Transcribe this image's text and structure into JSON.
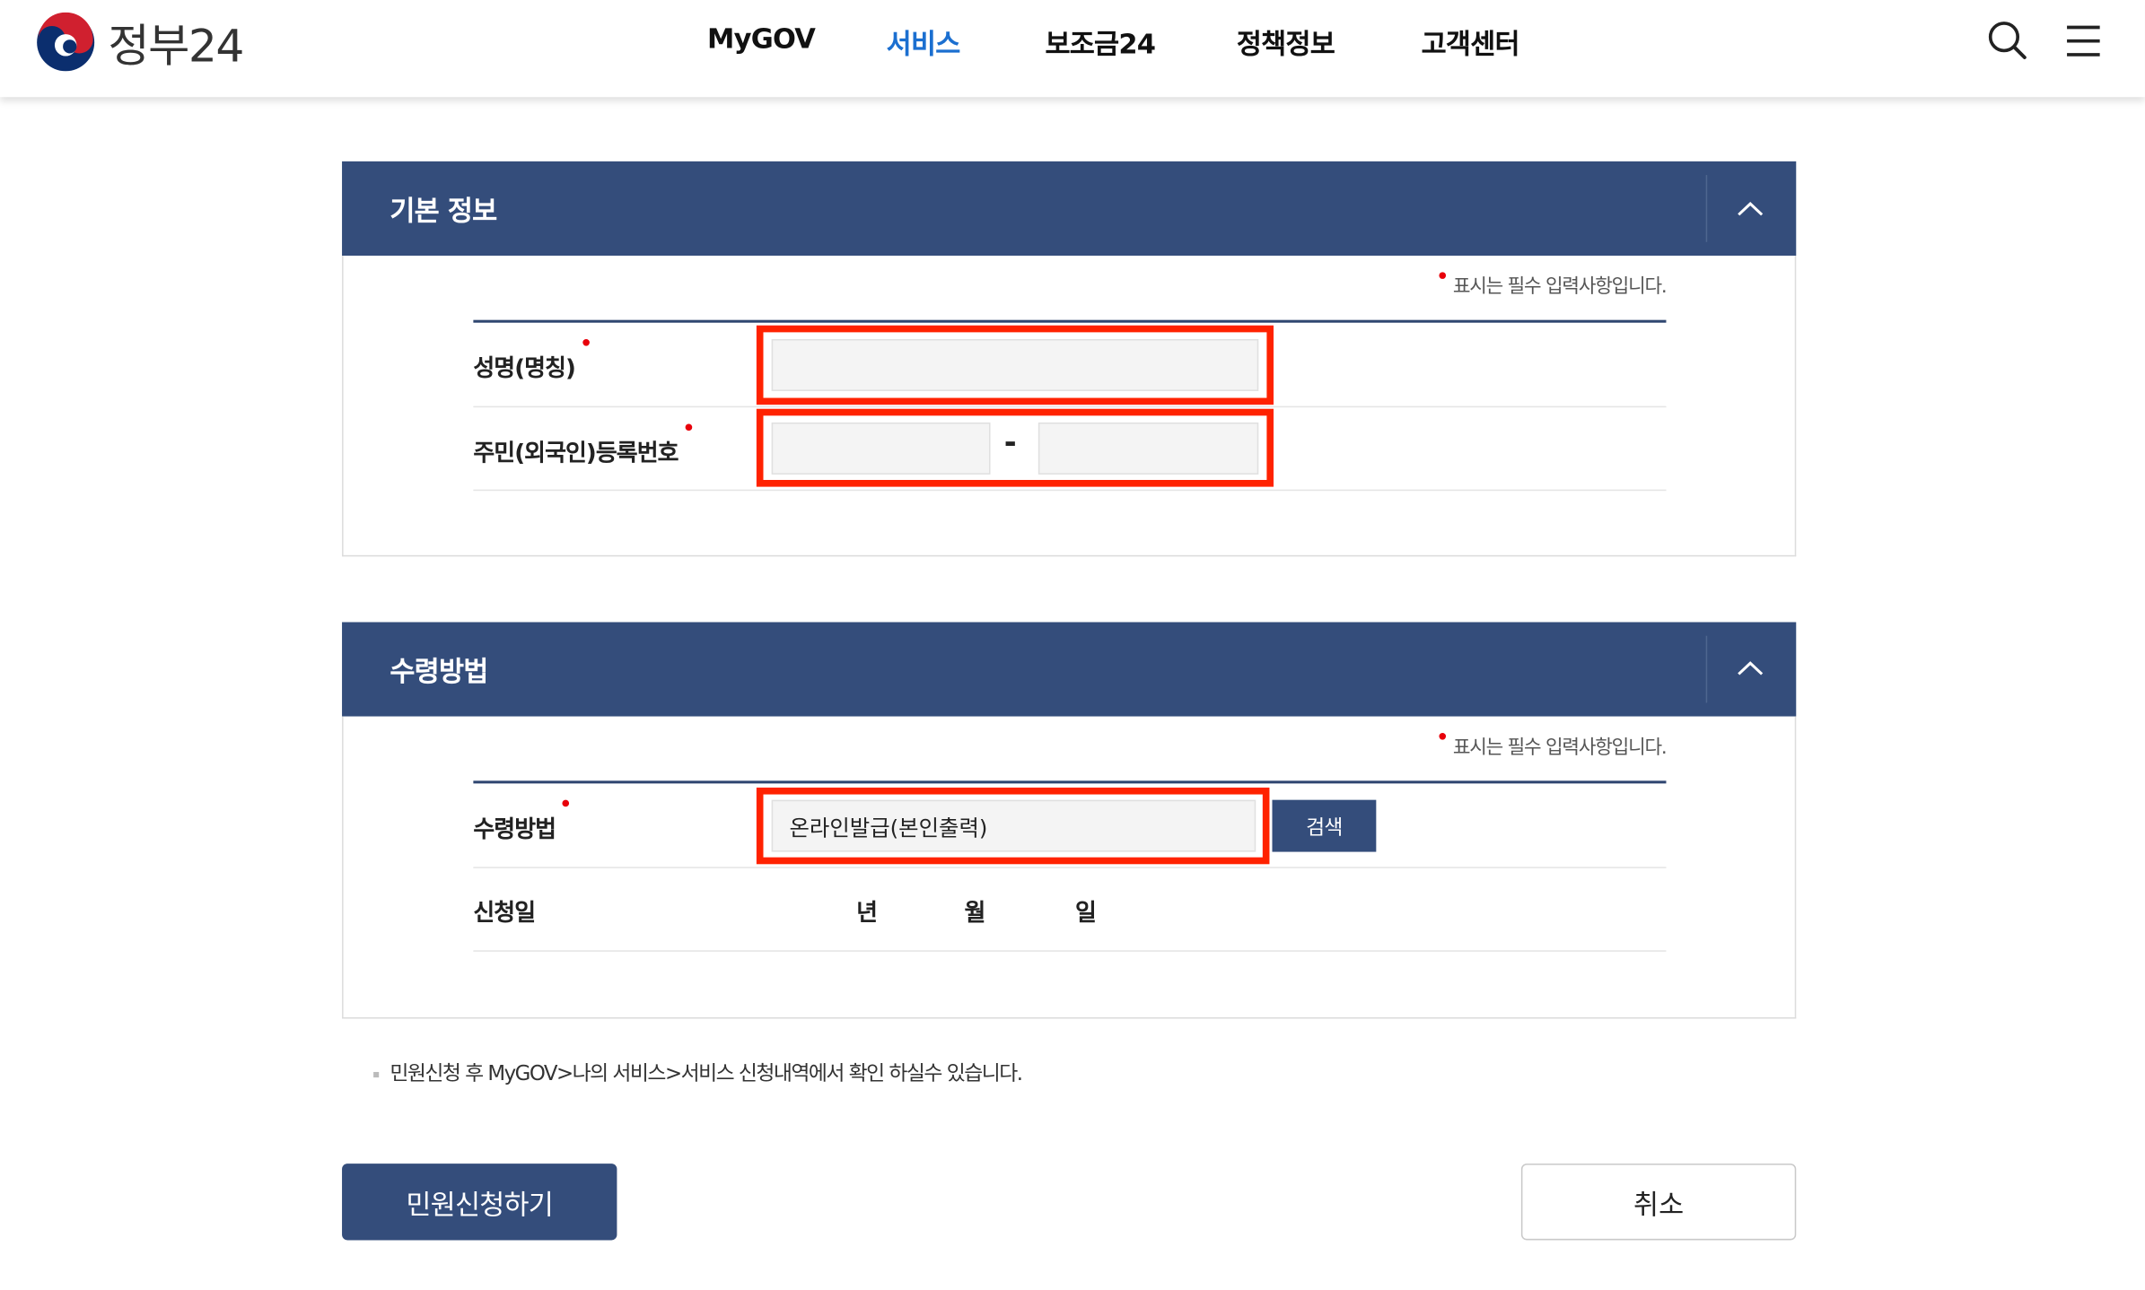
{
  "header": {
    "logo_text": "정부24",
    "nav": [
      "MyGOV",
      "서비스",
      "보조금24",
      "정책정보",
      "고객센터"
    ],
    "active_nav": "서비스",
    "search_icon": "search-icon",
    "menu_icon": "hamburger-menu-icon"
  },
  "colors": {
    "primary": "#344d7b",
    "active_nav": "#1b6fd0",
    "required_dot": "#e8000b",
    "highlight": "#ff2200"
  },
  "basic_info": {
    "title": "기본 정보",
    "required_note": "표시는 필수 입력사항입니다.",
    "name_label": "성명(명칭)",
    "name_value": "",
    "rrn_label": "주민(외국인)등록번호",
    "rrn_front_value": "",
    "rrn_back_value": "",
    "rrn_separator": "-"
  },
  "receipt": {
    "title": "수령방법",
    "required_note": "표시는 필수 입력사항입니다.",
    "method_label": "수령방법",
    "method_value": "온라인발급(본인출력)",
    "search_button": "검색",
    "date_label": "신청일",
    "year_unit": "년",
    "month_unit": "월",
    "day_unit": "일"
  },
  "notice": "민원신청 후 MyGOV>나의 서비스>서비스 신청내역에서 확인 하실수 있습니다.",
  "actions": {
    "submit": "민원신청하기",
    "cancel": "취소"
  }
}
